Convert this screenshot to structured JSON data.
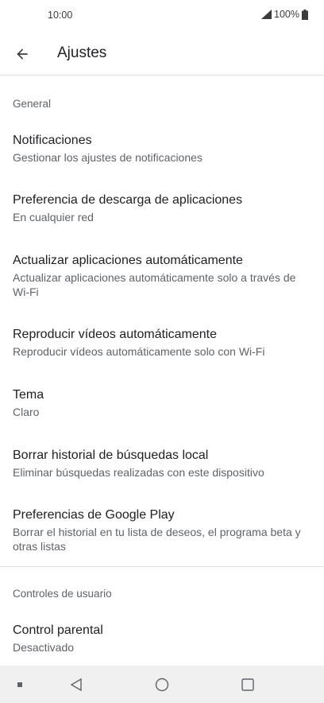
{
  "status_bar": {
    "time": "10:00",
    "battery": "100%"
  },
  "app_bar": {
    "title": "Ajustes"
  },
  "sections": {
    "general": "General",
    "user_controls": "Controles de usuario"
  },
  "items": {
    "notifications": {
      "title": "Notificaciones",
      "subtitle": "Gestionar los ajustes de notificaciones"
    },
    "download_pref": {
      "title": "Preferencia de descarga de aplicaciones",
      "subtitle": "En cualquier red"
    },
    "auto_update": {
      "title": "Actualizar aplicaciones automáticamente",
      "subtitle": "Actualizar aplicaciones automáticamente solo a través de Wi-Fi"
    },
    "autoplay": {
      "title": "Reproducir vídeos automáticamente",
      "subtitle": "Reproducir vídeos automáticamente solo con Wi-Fi"
    },
    "theme": {
      "title": "Tema",
      "subtitle": "Claro"
    },
    "clear_history": {
      "title": "Borrar historial de búsquedas local",
      "subtitle": "Eliminar búsquedas realizadas con este dispositivo"
    },
    "gplay_prefs": {
      "title": "Preferencias de Google Play",
      "subtitle": "Borrar el historial en tu lista de deseos, el programa beta y otras listas"
    },
    "parental": {
      "title": "Control parental",
      "subtitle": "Desactivado"
    }
  },
  "icons": {
    "back": "arrow-back-icon",
    "signal": "signal-icon",
    "battery": "battery-icon",
    "nav_menu": "square-dot-icon",
    "nav_back": "triangle-back-icon",
    "nav_home": "circle-home-icon",
    "nav_recents": "square-recents-icon"
  },
  "colors": {
    "text_primary": "#202124",
    "text_secondary": "#5f6368",
    "divider": "#e0e0e0",
    "nav_bar_bg": "#f0f0f0"
  }
}
